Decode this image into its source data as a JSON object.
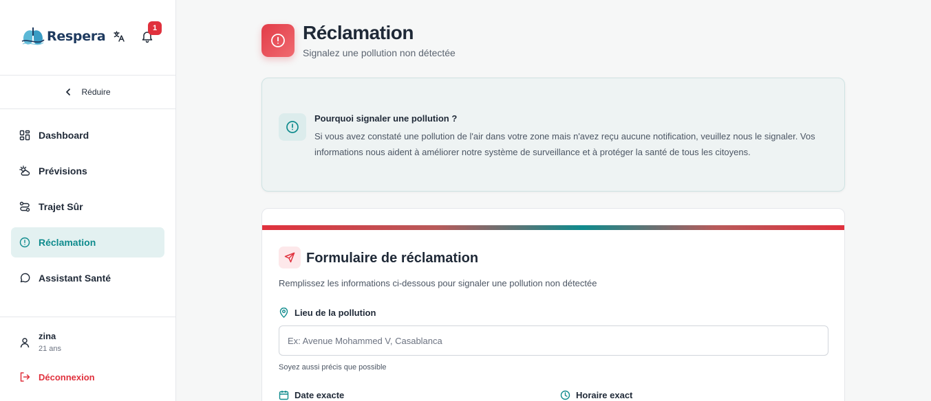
{
  "brand": {
    "name": "Respera"
  },
  "notifications": {
    "count": "1"
  },
  "sidebar": {
    "collapse_label": "Réduire",
    "items": [
      {
        "label": "Dashboard",
        "icon": "dashboard-icon"
      },
      {
        "label": "Prévisions",
        "icon": "weather-icon"
      },
      {
        "label": "Trajet Sûr",
        "icon": "route-icon"
      },
      {
        "label": "Réclamation",
        "icon": "alert-circle-icon",
        "active": true
      },
      {
        "label": "Assistant Santé",
        "icon": "chat-icon"
      }
    ],
    "user": {
      "name": "zina",
      "age": "21 ans"
    },
    "logout_label": "Déconnexion"
  },
  "header": {
    "title": "Réclamation",
    "subtitle": "Signalez une pollution non détectée"
  },
  "info": {
    "title": "Pourquoi signaler une pollution ?",
    "text": "Si vous avez constaté une pollution de l'air dans votre zone mais n'avez reçu aucune notification, veuillez nous le signaler. Vos informations nous aident à améliorer notre système de surveillance et à protéger la santé de tous les citoyens."
  },
  "form": {
    "title": "Formulaire de réclamation",
    "description": "Remplissez les informations ci-dessous pour signaler une pollution non détectée",
    "lieu_label": "Lieu de la pollution",
    "lieu_placeholder": "Ex: Avenue Mohammed V, Casablanca",
    "lieu_value": "",
    "lieu_hint": "Soyez aussi précis que possible",
    "date_label": "Date exacte",
    "time_label": "Horaire exact"
  },
  "colors": {
    "accent": "#0f8b8d",
    "danger": "#e0313d",
    "active_bg": "#e3f1f1"
  }
}
